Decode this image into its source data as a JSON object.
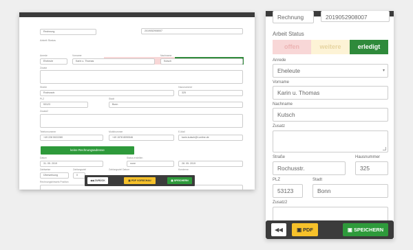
{
  "desktop": {
    "document_type_value": "Rechnung",
    "document_number_value": "2019052908007",
    "status_label": "Arbeit Status",
    "status_options": [
      "offen",
      "weitere",
      "erledigt"
    ],
    "labels": {
      "anrede": "Anrede",
      "vorname": "Vorname",
      "nachname": "Nachname",
      "zusatz": "Zusatz",
      "strasse": "Straße",
      "hausnummer": "Hausnummer",
      "plz": "PLZ",
      "stadt": "Stadt",
      "zusatz2": "Zusatz2",
      "telefon": "Telefonnummer",
      "mobil": "Mobilnummer",
      "email": "E-Mail",
      "datum": "Datum",
      "status_erstellen": "Status erstellen",
      "zahlweise": "Zahlweise",
      "zahlungsziel": "Zahlungsziel",
      "zahlungsziel_datum": "Zahlungsziel Datum",
      "kundennr": "Kundennr.",
      "hinweis": "Rechnungshinweis Position"
    },
    "values": {
      "anrede": "Eheleute",
      "vorname": "Karin u. Thomas",
      "nachname": "Kutsch",
      "strasse": "Rochusstr.",
      "hausnummer": "325",
      "plz": "53123",
      "stadt": "Bonn",
      "telefon": "+49 228 5022280",
      "mobil": "+49 1578 8090546",
      "email": "karin.kutsch@t-online.de",
      "datum": "31. 05. 2019",
      "status_erstellen": "none",
      "faellig": "28. 05. 2019",
      "zahlweise": "Überweisung",
      "zahlungsziel": "0"
    },
    "no_invoice_address_button": "keine Rechnungsadresse",
    "toolbar": {
      "back": "◀◀ ZURÜCK",
      "pdf": "▣ PDF VORSCHAU",
      "save": "▣ SPEICHERN"
    }
  },
  "mobile": {
    "document_type_value": "Rechnung",
    "document_number_value": "2019052908007",
    "status_label": "Arbeit Status",
    "status_options": [
      "offen",
      "weitere",
      "erledigt"
    ],
    "labels": {
      "anrede": "Anrede",
      "vorname": "Vorname",
      "nachname": "Nachname",
      "zusatz": "Zusatz",
      "strasse": "Straße",
      "hausnummer": "Hausnummer",
      "plz": "PLZ",
      "stadt": "Stadt",
      "zusatz2": "Zusatz2"
    },
    "values": {
      "anrede": "Eheleute",
      "vorname": "Karin u. Thomas",
      "nachname": "Kutsch",
      "strasse": "Rochusstr.",
      "hausnummer": "325",
      "plz": "53123",
      "stadt": "Bonn"
    },
    "toolbar": {
      "back": "◀◀",
      "pdf": "▣ PDF",
      "save": "▣ SPEICHERN"
    }
  },
  "colors": {
    "status_offen_bg": "#f8d7d7",
    "status_offen_fg": "#ecb3b3",
    "status_weitere_bg": "#fdf3d6",
    "status_weitere_fg": "#e6d4a0",
    "status_erledigt_bg": "#2f8a3b",
    "save_green": "#2e9a3b",
    "pdf_yellow": "#f6c12a",
    "toolbar_dark": "#3b3b3b"
  }
}
